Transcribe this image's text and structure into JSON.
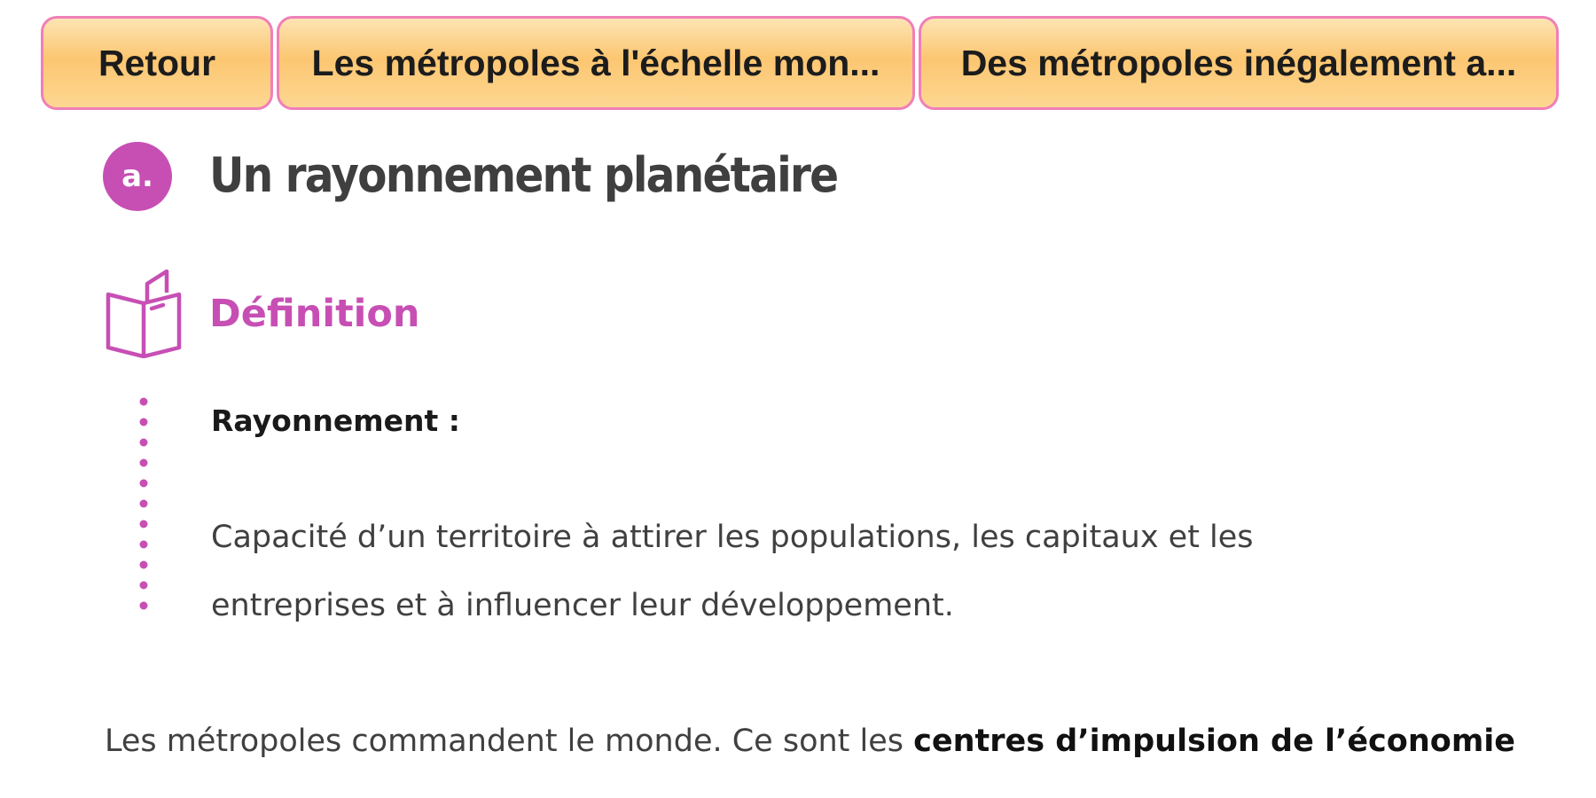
{
  "nav": {
    "back_label": "Retour",
    "prev_label": "Les métropoles à l'échelle mon...",
    "next_label": "Des métropoles inégalement a..."
  },
  "section": {
    "badge": "a.",
    "title": "Un rayonnement planétaire"
  },
  "definition": {
    "icon": "open-book-icon",
    "heading": "Définition",
    "term": "Rayonnement :",
    "text_line_1": "Capacité d’un territoire à attirer les populations, les capitaux et les",
    "text_line_2": "entreprises et à influencer leur développement."
  },
  "body": {
    "text_plain": "Les métropoles commandent le monde. Ce sont les ",
    "text_bold": "centres d’impulsion de l’économie"
  },
  "colors": {
    "accent": "#c74fb4",
    "button_border": "#f07fb8",
    "button_fill": "#fcc671",
    "heading_text": "#3f3f3f",
    "body_text": "#404040"
  }
}
